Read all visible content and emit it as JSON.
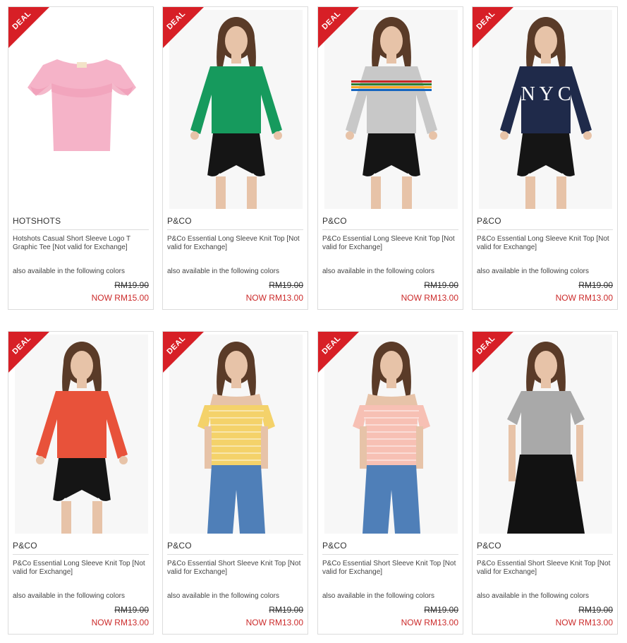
{
  "products": [
    {
      "brand": "HOTSHOTS",
      "name": "Hotshots Casual Short Sleeve Logo T Graphic Tee [Not valid for Exchange]",
      "availability": "also available in the following colors",
      "old_price": "RM19.90",
      "now_price": "NOW RM15.00",
      "badge": "DEAL",
      "top_color": "#f5b3c8",
      "bottom_color": "",
      "top_style": "flat-tee"
    },
    {
      "brand": "P&CO",
      "name": "P&Co Essential Long Sleeve Knit Top [Not valid for Exchange]",
      "availability": "also available in the following colors",
      "old_price": "RM19.00",
      "now_price": "NOW RM13.00",
      "badge": "DEAL",
      "top_color": "#169a5d",
      "bottom_color": "#151515",
      "top_style": "long-sleeve"
    },
    {
      "brand": "P&CO",
      "name": "P&Co Essential Long Sleeve Knit Top [Not valid for Exchange]",
      "availability": "also available in the following colors",
      "old_price": "RM19.00",
      "now_price": "NOW RM13.00",
      "badge": "DEAL",
      "top_color": "#c8c8c8",
      "bottom_color": "#151515",
      "top_style": "long-sleeve-stripe"
    },
    {
      "brand": "P&CO",
      "name": "P&Co Essential Long Sleeve Knit Top [Not valid for Exchange]",
      "availability": "also available in the following colors",
      "old_price": "RM19.00",
      "now_price": "NOW RM13.00",
      "badge": "DEAL",
      "top_color": "#1f2a4a",
      "bottom_color": "#151515",
      "top_style": "long-sleeve-nyc"
    },
    {
      "brand": "P&CO",
      "name": "P&Co Essential Long Sleeve Knit Top [Not valid for Exchange]",
      "availability": "also available in the following colors",
      "old_price": "RM19.00",
      "now_price": "NOW RM13.00",
      "badge": "DEAL",
      "top_color": "#e8523a",
      "bottom_color": "#151515",
      "top_style": "long-sleeve"
    },
    {
      "brand": "P&CO",
      "name": "P&Co Essential Short Sleeve Knit Top [Not valid for Exchange]",
      "availability": "also available in the following colors",
      "old_price": "RM19.00",
      "now_price": "NOW RM13.00",
      "badge": "DEAL",
      "top_color": "#f4d26a",
      "bottom_color": "#4f7fb8",
      "top_style": "off-shoulder"
    },
    {
      "brand": "P&CO",
      "name": "P&Co Essential Short Sleeve Knit Top [Not valid for Exchange]",
      "availability": "also available in the following colors",
      "old_price": "RM19.00",
      "now_price": "NOW RM13.00",
      "badge": "DEAL",
      "top_color": "#f7c0b4",
      "bottom_color": "#4f7fb8",
      "top_style": "off-shoulder"
    },
    {
      "brand": "P&CO",
      "name": "P&Co Essential Short Sleeve Knit Top [Not valid for Exchange]",
      "availability": "also available in the following colors",
      "old_price": "RM19.00",
      "now_price": "NOW RM13.00",
      "badge": "DEAL",
      "top_color": "#a9a9a9",
      "bottom_color": "#121212",
      "top_style": "tee-skirt"
    }
  ]
}
